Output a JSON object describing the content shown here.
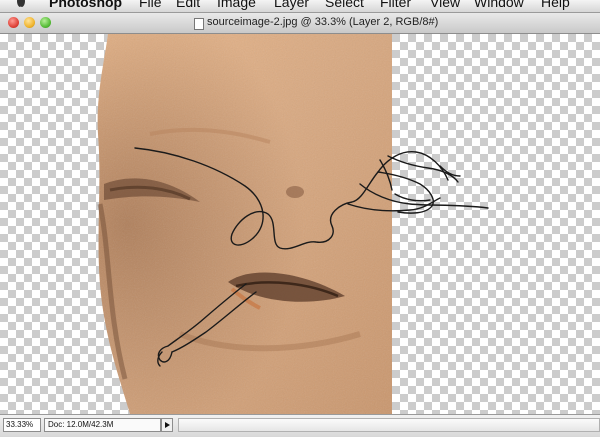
{
  "menubar": {
    "icon": "apple-icon",
    "items": [
      {
        "label": "Photoshop",
        "bold": true
      },
      {
        "label": "File"
      },
      {
        "label": "Edit"
      },
      {
        "label": "Image"
      },
      {
        "label": "Layer"
      },
      {
        "label": "Select"
      },
      {
        "label": "Filter"
      },
      {
        "label": "View"
      },
      {
        "label": "Window"
      },
      {
        "label": "Help"
      }
    ]
  },
  "window": {
    "title": "sourceimage-2.jpg @ 33.3% (Layer 2, RGB/8#)",
    "title_icon": "document-icon",
    "controls": [
      "close-button",
      "minimize-button",
      "zoom-button"
    ]
  },
  "canvas": {
    "background": "transparency-checkerboard",
    "layer": "rock-face-photo",
    "overlay": "ink-line-drawing",
    "colors": {
      "rock": "#d9a77c",
      "ink": "#1a1a1a",
      "checker": "#cccccc"
    }
  },
  "statusbar": {
    "zoom": "33.33%",
    "doc_info": "Doc: 12.0M/42.3M",
    "arrow_icon": "triangle-right-icon"
  }
}
